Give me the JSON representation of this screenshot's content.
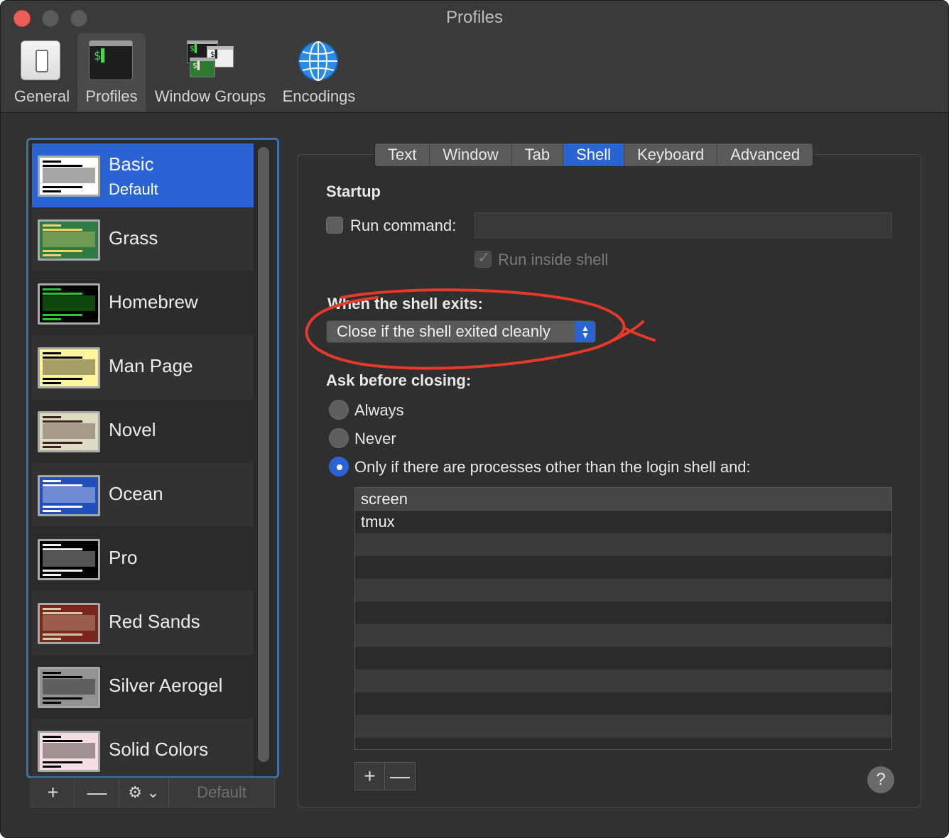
{
  "window": {
    "title": "Profiles"
  },
  "toolbar": {
    "items": [
      {
        "label": "General",
        "icon": "general-switch-icon"
      },
      {
        "label": "Profiles",
        "icon": "terminal-profiles-icon",
        "active": true
      },
      {
        "label": "Window Groups",
        "icon": "window-groups-icon"
      },
      {
        "label": "Encodings",
        "icon": "globe-icon"
      }
    ]
  },
  "profiles": {
    "items": [
      {
        "name": "Basic",
        "subtitle": "Default",
        "selected": true,
        "thumb_bg": "#ffffff",
        "thumb_fg": "#000000"
      },
      {
        "name": "Grass",
        "thumb_bg": "#2f7a45",
        "thumb_fg": "#f2d46e"
      },
      {
        "name": "Homebrew",
        "thumb_bg": "#000000",
        "thumb_fg": "#28c828"
      },
      {
        "name": "Man Page",
        "thumb_bg": "#fef49c",
        "thumb_fg": "#000000"
      },
      {
        "name": "Novel",
        "thumb_bg": "#dfdbc3",
        "thumb_fg": "#3b2322"
      },
      {
        "name": "Ocean",
        "thumb_bg": "#224fbc",
        "thumb_fg": "#ffffff"
      },
      {
        "name": "Pro",
        "thumb_bg": "#000000",
        "thumb_fg": "#f2f2f2"
      },
      {
        "name": "Red Sands",
        "thumb_bg": "#7a251e",
        "thumb_fg": "#d7c9a7"
      },
      {
        "name": "Silver Aerogel",
        "thumb_bg": "#929292",
        "thumb_fg": "#000000"
      },
      {
        "name": "Solid Colors",
        "thumb_bg": "#f7dde4",
        "thumb_fg": "#000000"
      }
    ],
    "buttons": {
      "add": "+",
      "remove": "—",
      "gear": "⚙ ⌄",
      "default": "Default"
    }
  },
  "tabs": [
    {
      "label": "Text"
    },
    {
      "label": "Window"
    },
    {
      "label": "Tab"
    },
    {
      "label": "Shell",
      "active": true
    },
    {
      "label": "Keyboard"
    },
    {
      "label": "Advanced"
    }
  ],
  "shell": {
    "startup_heading": "Startup",
    "run_command_label": "Run command:",
    "run_command_value": "",
    "run_command_checked": false,
    "run_inside_shell_label": "Run inside shell",
    "run_inside_shell_checked": true,
    "exit_heading": "When the shell exits:",
    "exit_action": "Close if the shell exited cleanly",
    "ask_heading": "Ask before closing:",
    "ask_options": [
      {
        "label": "Always",
        "selected": false
      },
      {
        "label": "Never",
        "selected": false
      },
      {
        "label": "Only if there are processes other than the login shell and:",
        "selected": true
      }
    ],
    "processes": [
      "screen",
      "tmux"
    ],
    "add_btn": "+",
    "remove_btn": "—",
    "help": "?"
  },
  "colors": {
    "accent": "#2a63d3",
    "annotation": "#e5392b",
    "window_bg": "#323232"
  }
}
